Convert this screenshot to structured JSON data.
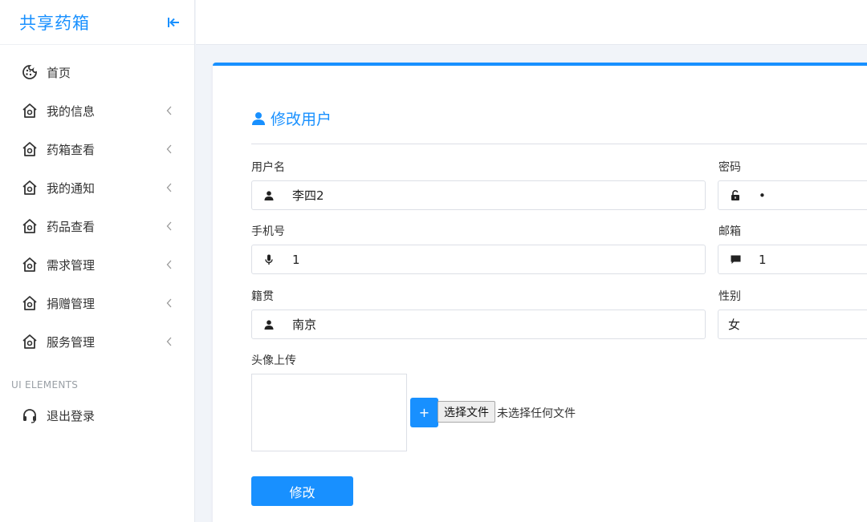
{
  "sidebar": {
    "brand": "共享药箱",
    "collapse_icon": "collapse-left-icon",
    "items": [
      {
        "label": "首页",
        "icon": "cookie-icon",
        "has_arrow": false
      },
      {
        "label": "我的信息",
        "icon": "home-icon",
        "has_arrow": true
      },
      {
        "label": "药箱查看",
        "icon": "home-icon",
        "has_arrow": true
      },
      {
        "label": "我的通知",
        "icon": "home-icon",
        "has_arrow": true
      },
      {
        "label": "药品查看",
        "icon": "home-icon",
        "has_arrow": true
      },
      {
        "label": "需求管理",
        "icon": "home-icon",
        "has_arrow": true
      },
      {
        "label": "捐赠管理",
        "icon": "home-icon",
        "has_arrow": true
      },
      {
        "label": "服务管理",
        "icon": "home-icon",
        "has_arrow": true
      }
    ],
    "section_label": "UI ELEMENTS",
    "logout": {
      "label": "退出登录",
      "icon": "headset-icon"
    }
  },
  "form": {
    "title": "修改用户",
    "username": {
      "label": "用户名",
      "value": "李四2"
    },
    "password": {
      "label": "密码",
      "value": "•"
    },
    "phone": {
      "label": "手机号",
      "value": "1"
    },
    "email": {
      "label": "邮箱",
      "value": "1"
    },
    "hometown": {
      "label": "籍贯",
      "value": "南京"
    },
    "gender": {
      "label": "性别",
      "value": "女"
    },
    "avatar": {
      "label": "头像上传",
      "plus_label": "+",
      "choose_file_label": "选择文件",
      "file_status": "未选择任何文件"
    },
    "submit_label": "修改"
  },
  "colors": {
    "accent": "#1890ff",
    "border": "#dcdfe6",
    "background": "#f1f4f9"
  }
}
